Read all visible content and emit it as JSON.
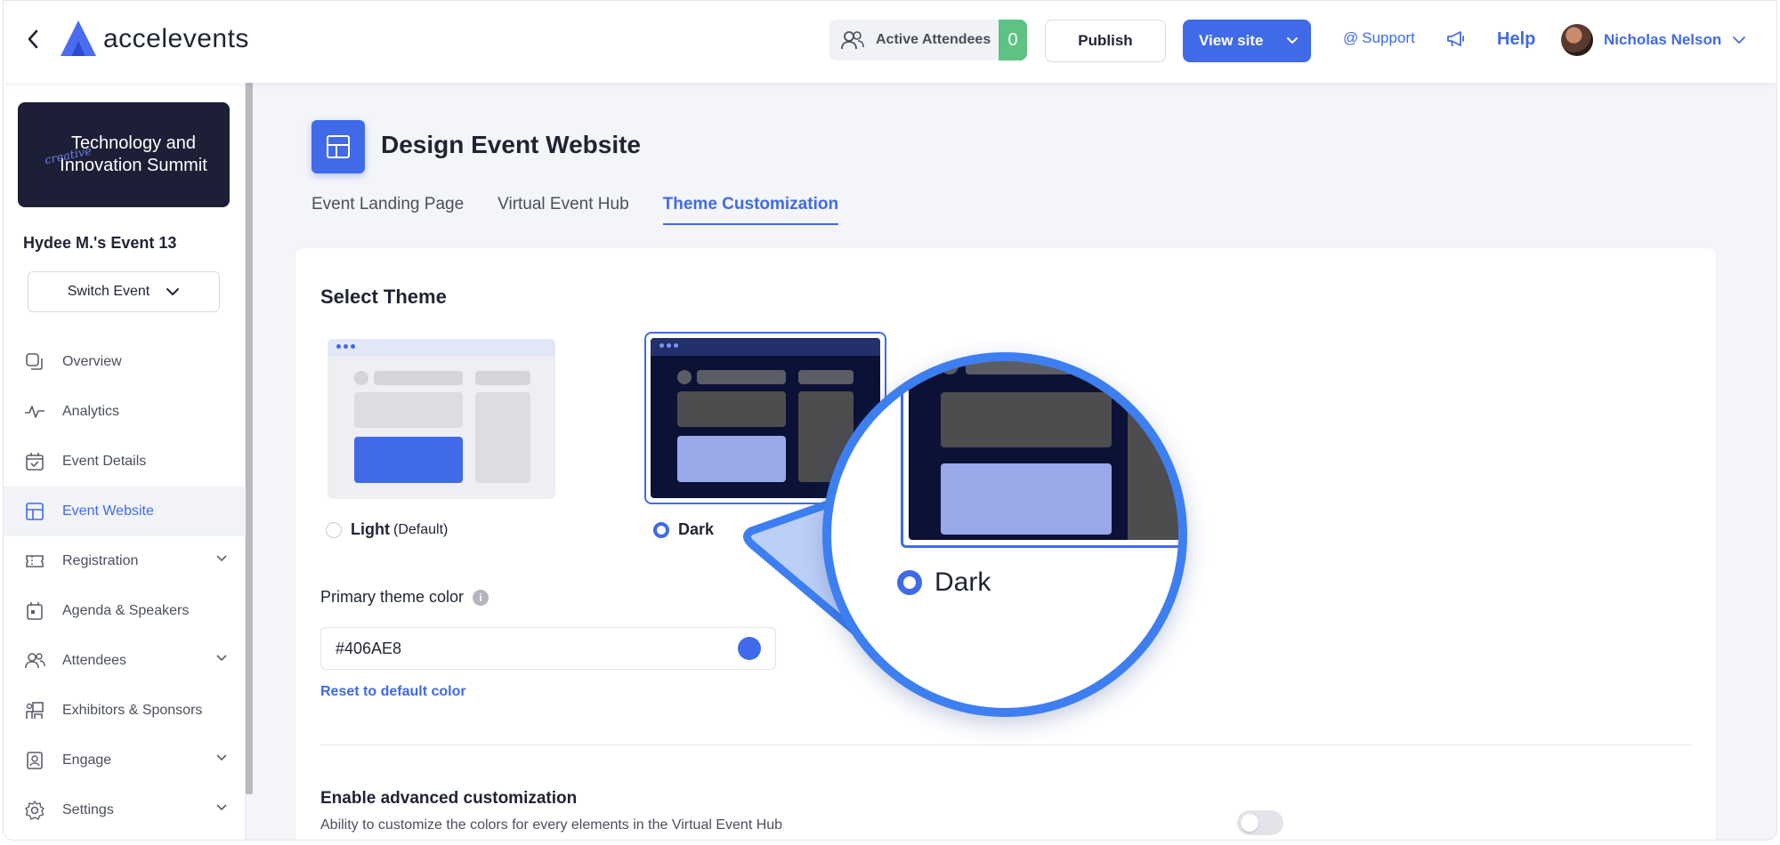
{
  "header": {
    "logo_text": "accelevents",
    "active_attendees_label": "Active Attendees",
    "active_attendees_count": "0",
    "publish_label": "Publish",
    "view_site_label": "View site",
    "support_label": "Support",
    "help_label": "Help",
    "user_name": "Nicholas Nelson"
  },
  "sidebar": {
    "event_card_title": "Technology and Innovation Summit",
    "event_card_script": "creative",
    "event_name": "Hydee M.'s Event 13",
    "switch_event_label": "Switch Event",
    "items": [
      {
        "label": "Overview",
        "icon": "overview-icon",
        "expandable": false
      },
      {
        "label": "Analytics",
        "icon": "analytics-icon",
        "expandable": false
      },
      {
        "label": "Event Details",
        "icon": "calendar-check-icon",
        "expandable": false
      },
      {
        "label": "Event Website",
        "icon": "layout-icon",
        "expandable": false,
        "active": true
      },
      {
        "label": "Registration",
        "icon": "ticket-icon",
        "expandable": true
      },
      {
        "label": "Agenda & Speakers",
        "icon": "calendar-icon",
        "expandable": false
      },
      {
        "label": "Attendees",
        "icon": "people-icon",
        "expandable": true
      },
      {
        "label": "Exhibitors & Sponsors",
        "icon": "booth-icon",
        "expandable": false
      },
      {
        "label": "Engage",
        "icon": "badge-icon",
        "expandable": true
      },
      {
        "label": "Settings",
        "icon": "gear-icon",
        "expandable": true
      }
    ]
  },
  "main": {
    "page_title": "Design Event Website",
    "tabs": [
      {
        "label": "Event Landing Page",
        "active": false
      },
      {
        "label": "Virtual Event Hub",
        "active": false
      },
      {
        "label": "Theme Customization",
        "active": true
      }
    ],
    "select_theme_title": "Select Theme",
    "theme_light_label": "Light",
    "theme_light_suffix": "(Default)",
    "theme_dark_label": "Dark",
    "selected_theme": "Dark",
    "primary_color_label": "Primary theme color",
    "primary_color_value": "#406AE8",
    "reset_label": "Reset to default color",
    "advanced_title": "Enable advanced customization",
    "advanced_desc": "Ability to customize the colors for every elements in the Virtual Event Hub",
    "advanced_enabled": false
  },
  "magnifier": {
    "label": "Dark"
  },
  "colors": {
    "accent": "#406AE8",
    "dark_theme_bg": "#0B1236",
    "attendee_count_bg": "#5EC283",
    "magnifier_ring": "#3D7FF0"
  }
}
